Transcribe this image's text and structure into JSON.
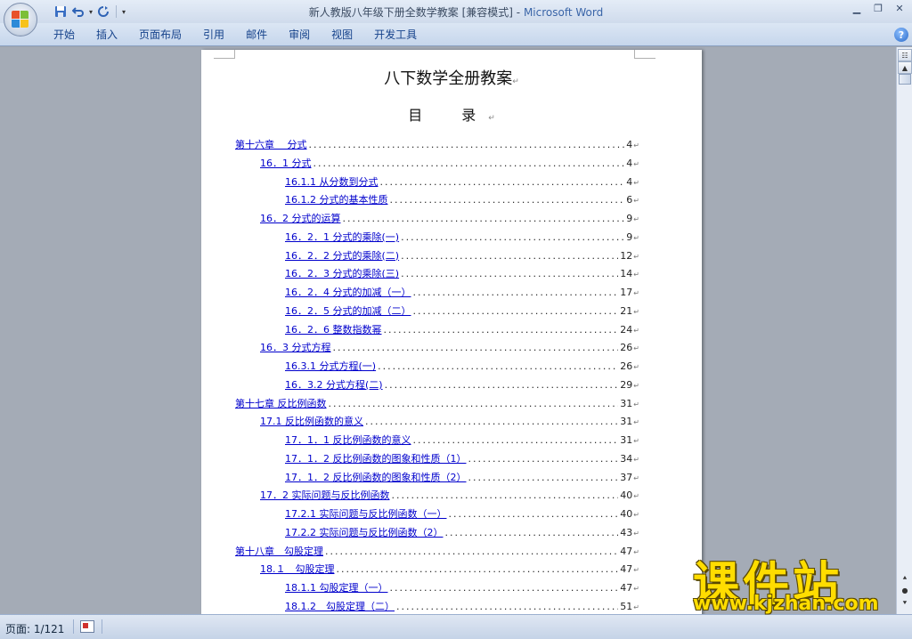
{
  "window": {
    "title_doc": "新人教版八年级下册全数学教案 [兼容模式]",
    "title_sep": " - ",
    "title_app": "Microsoft Word",
    "quick_access_icons": [
      "save-icon",
      "undo-icon",
      "redo-icon"
    ],
    "controls": [
      "minimize-icon",
      "restore-icon",
      "close-icon"
    ]
  },
  "ribbon": {
    "tabs": [
      "开始",
      "插入",
      "页面布局",
      "引用",
      "邮件",
      "审阅",
      "视图",
      "开发工具"
    ]
  },
  "document": {
    "title": "八下数学全册教案",
    "toc_heading": "目　录",
    "paragraph_mark": "↵",
    "toc": [
      {
        "label": "第十六章　 分式",
        "page": "4",
        "level": 1
      },
      {
        "label": "16．1 分式",
        "page": "4",
        "level": 2
      },
      {
        "label": "16.1.1 从分数到分式",
        "page": "4",
        "level": 3
      },
      {
        "label": "16.1.2 分式的基本性质",
        "page": "6",
        "level": 3
      },
      {
        "label": "16．2 分式的运算",
        "page": "9",
        "level": 2
      },
      {
        "label": "16．2．1 分式的乘除(一)",
        "page": "9",
        "level": 3
      },
      {
        "label": "16．2．2 分式的乘除(二)",
        "page": "12",
        "level": 3
      },
      {
        "label": "16．2．3 分式的乘除(三)",
        "page": "14",
        "level": 3
      },
      {
        "label": "16．2．4 分式的加减（一）",
        "page": "17",
        "level": 3
      },
      {
        "label": "16．2．5 分式的加减（二）",
        "page": "21",
        "level": 3
      },
      {
        "label": "16．2．6 整数指数幂",
        "page": "24",
        "level": 3
      },
      {
        "label": "16．3 分式方程",
        "page": "26",
        "level": 2
      },
      {
        "label": "16.3.1 分式方程(一)",
        "page": "26",
        "level": 3
      },
      {
        "label": "16．3.2 分式方程(二)",
        "page": "29",
        "level": 3
      },
      {
        "label": "第十七章 反比例函数",
        "page": "31",
        "level": 1
      },
      {
        "label": "17.1 反比例函数的意义",
        "page": "31",
        "level": 2
      },
      {
        "label": "17．1．1 反比例函数的意义",
        "page": "31",
        "level": 3
      },
      {
        "label": "17．1．2 反比例函数的图象和性质（1）",
        "page": "34",
        "level": 3
      },
      {
        "label": "17．1．2 反比例函数的图象和性质（2）",
        "page": "37",
        "level": 3
      },
      {
        "label": "17．2 实际问题与反比例函数",
        "page": "40",
        "level": 2
      },
      {
        "label": "17.2.1 实际问题与反比例函数（一）",
        "page": "40",
        "level": 3
      },
      {
        "label": "17.2.2 实际问题与反比例函数（2）",
        "page": "43",
        "level": 3
      },
      {
        "label": "第十八章　勾股定理",
        "page": "47",
        "level": 1
      },
      {
        "label": "18.１　勾股定理",
        "page": "47",
        "level": 2
      },
      {
        "label": "18.1.1 勾股定理（一）",
        "page": "47",
        "level": 3
      },
      {
        "label": "18.1.2　勾股定理（二）",
        "page": "51",
        "level": 3
      }
    ]
  },
  "statusbar": {
    "page_label": "页面: 1/121"
  },
  "watermark": {
    "brand": "课件站",
    "url": "www.kjzhan.com"
  }
}
